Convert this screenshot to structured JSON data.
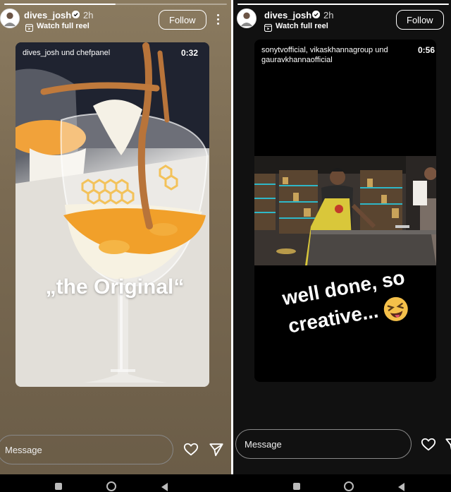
{
  "left_story": {
    "progress": 0.5,
    "username": "dives_josh",
    "time": "2h",
    "reel_label": "Watch full reel",
    "follow_label": "Follow",
    "credit": "dives_josh und chefpanel",
    "duration": "0:32",
    "caption": "„the Original“",
    "message_placeholder": "Message"
  },
  "right_story": {
    "progress": 1.0,
    "username": "dives_josh",
    "time": "2h",
    "reel_label": "Watch full reel",
    "follow_label": "Follow",
    "credit_line1": "sonytvofficial, vikaskhannagroup und",
    "credit_line2": "gauravkhannaofficial",
    "duration": "0:56",
    "caption_line1": "well done, so",
    "caption_line2": "creative...",
    "message_placeholder": "Message"
  },
  "icons": {
    "verified": "verified-badge-icon",
    "reel": "reel-icon",
    "more": "more-options-icon",
    "like": "heart-icon",
    "share": "send-icon",
    "emoji": "winking-tongue-emoji"
  },
  "colors": {
    "accent": "#ffffff",
    "emoji": "#f5c04a",
    "apron": "#d9c73a"
  }
}
